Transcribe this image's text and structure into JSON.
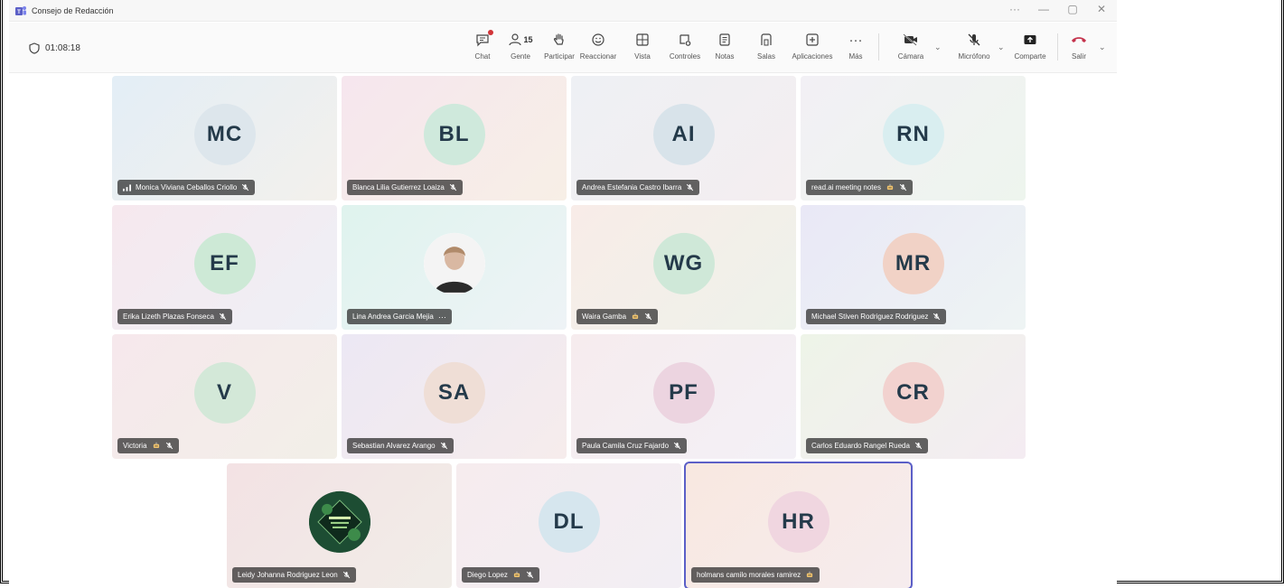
{
  "window": {
    "title": "Consejo de Redacción",
    "minimize": "—",
    "restore": "▢",
    "close": "✕",
    "more": "···"
  },
  "toolbar": {
    "timer": "01:08:18",
    "people_count": "15",
    "buttons": {
      "chat": "Chat",
      "people": "Gente",
      "raise": "Participar",
      "react": "Reaccionar",
      "view": "Vista",
      "controls": "Controles",
      "notes": "Notas",
      "rooms": "Salas",
      "apps": "Aplicaciones",
      "more": "Más",
      "camera": "Cámara",
      "mic": "Micrófono",
      "share": "Comparte",
      "leave": "Salir"
    }
  },
  "participants": [
    {
      "initials": "MC",
      "name": "Monica Viviana Ceballos Criollo",
      "bg": "#dde6ec",
      "tile": "linear-gradient(135deg,#e3eef6,#f3f0ec)",
      "ic": "mic"
    },
    {
      "initials": "BL",
      "name": "Blanca Lilia Gutierrez Loaiza",
      "bg": "#cfe9dc",
      "tile": "linear-gradient(135deg,#f6e6ee,#f7efe6)",
      "ic": "mic"
    },
    {
      "initials": "AI",
      "name": "Andrea Estefania Castro Ibarra",
      "bg": "#d8e3ea",
      "tile": "linear-gradient(135deg,#eef0f4,#f4eef0)",
      "ic": "mic"
    },
    {
      "initials": "RN",
      "name": "read.ai meeting notes",
      "bg": "#d9eef0",
      "tile": "linear-gradient(135deg,#f2f0f5,#eef5ee)",
      "ic": "bot"
    },
    {
      "initials": "EF",
      "name": "Erika Lizeth Plazas Fonseca",
      "bg": "#cde9d6",
      "tile": "linear-gradient(135deg,#f6e8ee,#eef0f6)",
      "ic": "mic"
    },
    {
      "initials": "",
      "name": "Lina Andrea Garcia Mejia",
      "bg": "#ffffff",
      "tile": "linear-gradient(135deg,#dff3ee,#eef3f6)",
      "ic": "more",
      "photo": true
    },
    {
      "initials": "WG",
      "name": "Waira Gamba",
      "bg": "#cfe8d8",
      "tile": "linear-gradient(135deg,#f8ece8,#eef2ea)",
      "ic": "bot"
    },
    {
      "initials": "MR",
      "name": "Michael Stiven Rodriguez Rodriguez",
      "bg": "#f1d2c6",
      "tile": "linear-gradient(135deg,#e9e8f6,#eef4f4)",
      "ic": "mic"
    },
    {
      "initials": "V",
      "name": "Victoria",
      "bg": "#d3e8d8",
      "tile": "linear-gradient(135deg,#f6e8ec,#f2efe8)",
      "ic": "bot"
    },
    {
      "initials": "SA",
      "name": "Sebastian Alvarez Arango",
      "bg": "#efded6",
      "tile": "linear-gradient(135deg,#ece8f4,#f6ecec)",
      "ic": "mic"
    },
    {
      "initials": "PF",
      "name": "Paula Camila Cruz Fajardo",
      "bg": "#ecd4e0",
      "tile": "linear-gradient(135deg,#f6ecee,#f3f0f6)",
      "ic": "mic"
    },
    {
      "initials": "CR",
      "name": "Carlos Eduardo Rangel Rueda",
      "bg": "#f2d2cf",
      "tile": "linear-gradient(135deg,#eef4e8,#f4ecf2)",
      "ic": "mic"
    },
    {
      "initials": "",
      "name": "Leidy Johanna Rodriguez Leon",
      "bg": "#1f5a3a",
      "tile": "linear-gradient(135deg,#f3e2e4,#f1ede8)",
      "ic": "mic",
      "logo": true
    },
    {
      "initials": "DL",
      "name": "Diego Lopez",
      "bg": "#d6e6ee",
      "tile": "linear-gradient(135deg,#f6ecee,#f2eef4)",
      "ic": "bot"
    },
    {
      "initials": "HR",
      "name": "holmans camilo morales ramirez",
      "bg": "#f0d6e0",
      "tile": "linear-gradient(135deg,#f8e8e0,#f6ecee)",
      "ic": "bot-only",
      "active": true
    }
  ]
}
